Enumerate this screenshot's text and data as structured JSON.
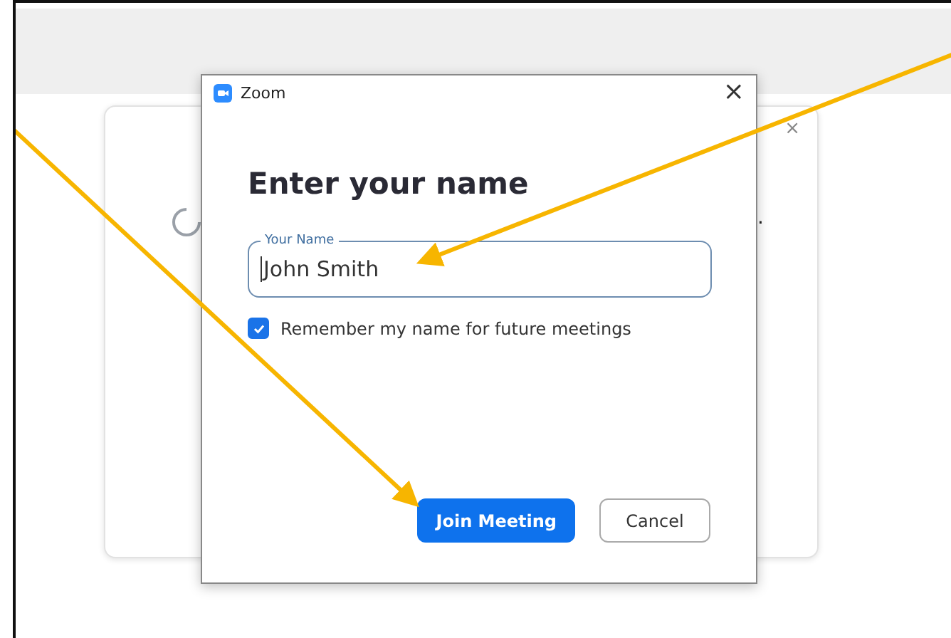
{
  "background_card": {
    "close": "×",
    "fragment": "."
  },
  "dialog": {
    "title": "Zoom",
    "close": "×",
    "heading": "Enter your name",
    "name_field": {
      "label": "Your Name",
      "value": "John Smith"
    },
    "remember": {
      "label": "Remember my name for future meetings",
      "checked": true
    },
    "buttons": [
      {
        "label": "Join Meeting",
        "kind": "primary"
      },
      {
        "label": "Cancel",
        "kind": "secondary"
      }
    ]
  }
}
